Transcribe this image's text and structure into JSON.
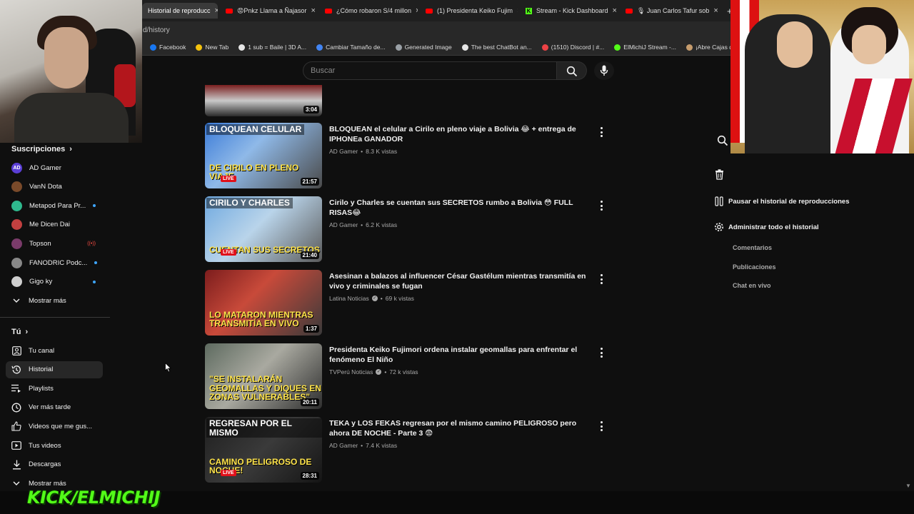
{
  "tabs": [
    {
      "label": "Historial de reproducc",
      "icon": "none",
      "active": true
    },
    {
      "label": "😡Pnkz Llama a Ñajasor",
      "icon": "youtube"
    },
    {
      "label": "¿Cómo robaron S/4 millon",
      "icon": "youtube"
    },
    {
      "label": "(1) Presidenta Keiko Fujim",
      "icon": "youtube"
    },
    {
      "label": "Stream - Kick Dashboard",
      "icon": "kick"
    },
    {
      "label": "🎙 Juan Carlos Tafur sob",
      "icon": "youtube"
    }
  ],
  "new_tab_symbol": "+",
  "close_symbol": "×",
  "url": "d/history",
  "bookmarks": [
    {
      "label": "Facebook",
      "color": "#1877f2"
    },
    {
      "label": "New Tab",
      "color": "#f4c20d"
    },
    {
      "label": "1 sub = Baile | 3D A...",
      "color": "#e6e6e6"
    },
    {
      "label": "Cambiar Tamaño de...",
      "color": "#4285f4"
    },
    {
      "label": "Generated Image",
      "color": "#9aa0a6"
    },
    {
      "label": "The best ChatBot an...",
      "color": "#e6e6e6"
    },
    {
      "label": "(1510) Discord | #...",
      "color": "#ed4245"
    },
    {
      "label": "ElMichiJ Stream -...",
      "color": "#53fc18"
    },
    {
      "label": "¡Abre Cajas de CS2 (...",
      "color": "#c69c6d"
    }
  ],
  "search": {
    "placeholder": "Buscar"
  },
  "sidebar": {
    "subscriptions_header": "Suscripciones",
    "subscriptions": [
      {
        "name": "AD Gamer",
        "avatar_text": "AD",
        "avatar_color": "#5b3fd6",
        "indicator": "none"
      },
      {
        "name": "VanN Dota",
        "avatar_text": "",
        "avatar_color": "#7a4a2a",
        "indicator": "none"
      },
      {
        "name": "Metapod Para Pr...",
        "avatar_text": "",
        "avatar_color": "#2fb98e",
        "indicator": "dot"
      },
      {
        "name": "Me Dicen Dai",
        "avatar_text": "",
        "avatar_color": "#c24040",
        "indicator": "none"
      },
      {
        "name": "Topson",
        "avatar_text": "",
        "avatar_color": "#7a3b6a",
        "indicator": "live"
      },
      {
        "name": "FANODRIC Podc...",
        "avatar_text": "",
        "avatar_color": "#888888",
        "indicator": "dot"
      },
      {
        "name": "Gigo ky",
        "avatar_text": "",
        "avatar_color": "#cfcfcf",
        "indicator": "dot"
      }
    ],
    "show_more": "Mostrar más",
    "you_header": "Tú",
    "you_items": [
      {
        "label": "Tu canal",
        "icon": "channel-icon"
      },
      {
        "label": "Historial",
        "icon": "history-icon",
        "active": true
      },
      {
        "label": "Playlists",
        "icon": "playlist-icon"
      },
      {
        "label": "Ver más tarde",
        "icon": "clock-icon"
      },
      {
        "label": "Videos que me gus...",
        "icon": "thumbs-up-icon"
      },
      {
        "label": "Tus videos",
        "icon": "video-icon"
      },
      {
        "label": "Descargas",
        "icon": "download-icon"
      },
      {
        "label": "Mostrar más",
        "icon": "chevron-down-icon"
      }
    ]
  },
  "videos": [
    {
      "title": "",
      "channel": "",
      "views": "",
      "duration": "3:04",
      "verified": false,
      "thumb_top": "",
      "thumb_bottom": "",
      "thumb_bg": "linear-gradient(180deg,#7a1f1f 0%,#c9c9c9 50%,#2a2a2a 100%)"
    },
    {
      "title": "BLOQUEAN el celular a Cirilo en pleno viaje a Bolivia 😂 + entrega de IPHONEa GANADOR",
      "channel": "AD Gamer",
      "views": "8.3 K vistas",
      "duration": "21:57",
      "verified": false,
      "thumb_top": "BLOQUEAN CELULAR",
      "thumb_bottom": "DE CIRILO EN PLENO VIAJE",
      "thumb_bg": "linear-gradient(135deg,#3b7bd8 0%,#8fb9e8 40%,#4a4a4a 100%)",
      "live": true
    },
    {
      "title": "Cirilo y Charles se cuentan sus SECRETOS rumbo a Bolivia 😳 FULL RISAS😂",
      "channel": "AD Gamer",
      "views": "6.2 K vistas",
      "duration": "21:40",
      "verified": false,
      "thumb_top": "CIRILO Y CHARLES",
      "thumb_bottom": "CUENTAN SUS SECRETOS",
      "thumb_bg": "linear-gradient(135deg,#6fa9e0 0%,#b9d4ea 45%,#5a5a5a 100%)",
      "live": true
    },
    {
      "title": "Asesinan a balazos al influencer César Gastélum mientras transmitía en vivo y criminales se fugan",
      "channel": "Latina Noticias",
      "views": "69 k vistas",
      "duration": "1:37",
      "verified": true,
      "thumb_top": "",
      "thumb_bottom": "LO MATARON MIENTRAS TRANSMITÍA EN VIVO",
      "thumb_bg": "linear-gradient(135deg,#7c1d1d 0%,#c84a3a 40%,#3a3a3a 100%)"
    },
    {
      "title": "Presidenta Keiko Fujimori ordena instalar geomallas para enfrentar el fenómeno El Niño",
      "channel": "TVPerú Noticias",
      "views": "72 k vistas",
      "duration": "20:11",
      "verified": true,
      "thumb_top": "",
      "thumb_bottom": "\"Se instalarán geomallas y diques en zonas vulnerables\"",
      "thumb_bg": "linear-gradient(135deg,#5e6b60 0%,#a9a9a0 45%,#2e2e2e 100%)"
    },
    {
      "title": "TEKA y LOS FEKAS regresan por el mismo camino PELIGROSO pero ahora DE NOCHE - Parte 3 😨",
      "channel": "AD Gamer",
      "views": "7.4 K vistas",
      "duration": "28:31",
      "verified": false,
      "thumb_top": "REGRESAN POR EL MISMO",
      "thumb_bottom": "CAMINO PELIGROSO DE NOCHE!",
      "thumb_bg": "linear-gradient(135deg,#1f1f1f 0%,#3a3a3a 50%,#151515 100%)",
      "live": true
    }
  ],
  "live_badge": "LIVE",
  "right_panel": {
    "pause_history": "Pausar el historial de reproducciones",
    "manage_history": "Administrar todo el historial",
    "sub_items": [
      "Comentarios",
      "Publicaciones",
      "Chat en vivo"
    ]
  },
  "overlay": {
    "kick_handle": "KICK/ELMICHIJ"
  },
  "colors": {
    "background": "#0f0f0f",
    "kick_green": "#53fc18",
    "accent_blue": "#3ea6ff"
  }
}
